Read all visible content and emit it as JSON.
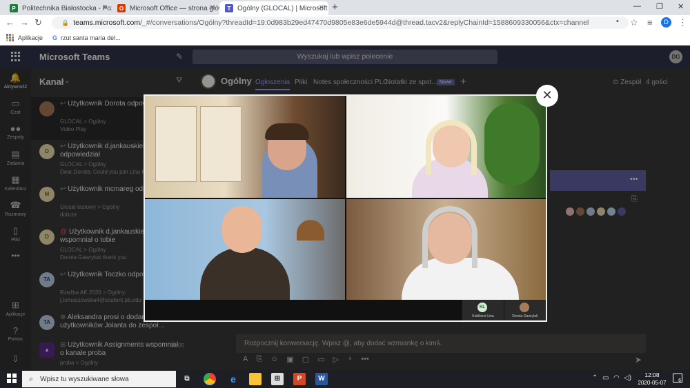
{
  "browser": {
    "tabs": [
      {
        "title": "Politechnika Białostocka - Pozost"
      },
      {
        "title": "Microsoft Office — strona główn"
      },
      {
        "title": "Ogólny (GLOCAL) | Microsoft"
      }
    ],
    "url_host": "teams.microsoft.com",
    "url_path": "/_#/conversations/Ogólny?threadId=19:0d983b29ed47470d9805e83e6de5944d@thread.tacv2&replyChainId=1588609330056&ctx=channel",
    "bookmarks": [
      "Aplikacje",
      "rzut santa maria del..."
    ]
  },
  "teams": {
    "app_title": "Microsoft Teams",
    "search_placeholder": "Wyszukaj lub wpisz polecenie",
    "user_initials": "DG",
    "rail": [
      "Aktywność",
      "Czat",
      "Zespoły",
      "Zadania",
      "Kalendarz",
      "Rozmowy",
      "Pliki",
      "Aplikacje",
      "Pomoc"
    ],
    "list_title": "Kanał",
    "activity": [
      {
        "initials": "",
        "title": "Użytkownik Dorota odpowiedział",
        "line1": "GLOCAL > Ogólny",
        "line2": "Video Play",
        "date": ""
      },
      {
        "initials": "D",
        "title": "Użytkownik d.jankauskiene odpowiedział",
        "line1": "GLOCAL > Ogólny",
        "line2": "Dear Dorota, Could you join Lina K",
        "date": ""
      },
      {
        "initials": "M",
        "title": "Użytkownik mcmareg odpowiedział",
        "line1": "Glocal testowy > Ogólny",
        "line2": "dobrze",
        "date": ""
      },
      {
        "initials": "D",
        "title": "Użytkownik d.jankauskiene wspomniał o tobie",
        "line1": "GLOCAL > Ogólny",
        "line2": "Dorota Gawryluk thank you",
        "date": ""
      },
      {
        "initials": "TA",
        "title": "Użytkownik Toczko odpowiedział",
        "line1": "Rzeźba AK 2020 > Ogólny",
        "line2": "j.tomaszewska4@student.pb.edu",
        "date": ""
      },
      {
        "initials": "TA",
        "title": "Aleksandra prosi o dodanie użytkowników Jolanta do zespoł...",
        "line1": "",
        "line2": "",
        "date": ""
      },
      {
        "initials": "",
        "title": "Użytkownik Assignments wspomniał o kanale proba",
        "line1": "proba > Ogólny",
        "line2": "",
        "date": "05.05"
      }
    ],
    "channel": {
      "name": "Ogólny",
      "tabs": [
        "Ogłoszenia",
        "Pliki",
        "Notes społeczności PLC",
        "Notatki ze spot...",
        "Nowe"
      ],
      "team_label": "Zespół",
      "guests": "4 gości",
      "compose_placeholder": "Rozpocznij konwersację. Wpisz @, aby dodać wzmiankę o kimś."
    },
    "call": {
      "thumbs": [
        {
          "initials": "KL",
          "name": "Kubilienė Lina"
        },
        {
          "initials": "",
          "name": "Dorota Gawryluk"
        }
      ]
    }
  },
  "taskbar": {
    "search_placeholder": "Wpisz tu wyszukiwane słowa",
    "time": "12:08",
    "date": "2020-05-07",
    "notifications": "6"
  }
}
